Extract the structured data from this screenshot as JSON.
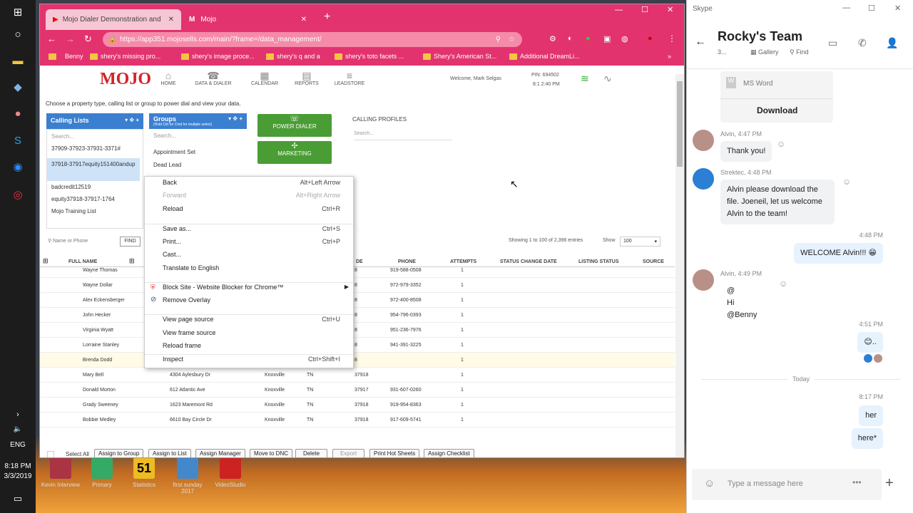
{
  "taskbar": {
    "time": "8:18 PM",
    "date": "3/3/2019",
    "lang": "ENG"
  },
  "desktop_icons": [
    {
      "label": "Kevin  Interview",
      "color": "#a34"
    },
    {
      "label": "Primary",
      "color": "#3a6"
    },
    {
      "label": "Statistics",
      "color": "#eb2",
      "badge": "51"
    },
    {
      "label": "first sunday 2017",
      "color": "#48c"
    },
    {
      "label": "VideoStudio",
      "color": "#c22"
    }
  ],
  "browser": {
    "tabs": [
      {
        "label": "Mojo Dialer Demonstration and C"
      },
      {
        "label": "Mojo"
      }
    ],
    "url": "https://app351.mojosells.com/main/?frame=/data_management/",
    "bookmarks": [
      "Benny",
      "shery's missing pro...",
      "shery's image proce...",
      "shery's q and a",
      "shery's toto facets ...",
      "Shery's American St...",
      "Additional DreamLi..."
    ]
  },
  "mojo": {
    "nav": [
      {
        "label": "HOME",
        "icon": "⌂"
      },
      {
        "label": "DATA & DIALER",
        "icon": "☎"
      },
      {
        "label": "CALENDAR",
        "icon": "▦"
      },
      {
        "label": "REPORTS",
        "icon": "▤"
      },
      {
        "label": "LEADSTORE",
        "icon": "≡"
      }
    ],
    "welcome": "Welcome, Mark Selgas",
    "pin": "PIN: 694502",
    "clock": "8:1 2:40 PM",
    "instruction": "Choose a property type, calling list or group to power dial and view your data.",
    "calling_lists": {
      "title": "Calling Lists",
      "search": "Search...",
      "items": [
        "37909-37923-37931-3371#",
        "37918-37917equity151400andup",
        "badcredit12519",
        "equity37918-37917-1764",
        "Mojo Training List"
      ]
    },
    "groups": {
      "title": "Groups",
      "subtitle": "(Hold Ctrl for Cmd for multiple select)",
      "search": "Search...",
      "items": [
        "Appointment Set",
        "Dead Lead"
      ]
    },
    "power_dialer": "POWER DIALER",
    "marketing": "MARKETING",
    "calling_profiles": "CALLING PROFILES",
    "profiles_search": "Search...",
    "name_search": "Name or Phone",
    "find": "FIND",
    "showing": "Showing 1 to 100 of 2,396 entries",
    "show_label": "Show",
    "show_val": "100",
    "columns": [
      "FULL NAME",
      "DE",
      "PHONE",
      "ATTEMPTS",
      "STATUS CHANGE DATE",
      "LISTING STATUS",
      "SOURCE"
    ],
    "rows": [
      {
        "name": "Wayne Thomas",
        "addr": "",
        "city": "",
        "st": "",
        "zip": "8",
        "phone": "919-588-0508",
        "att": "1"
      },
      {
        "name": "Wayne Dollar",
        "addr": "",
        "city": "",
        "st": "",
        "zip": "8",
        "phone": "972-979-3352",
        "att": "1"
      },
      {
        "name": "Alex Eckensberger",
        "addr": "",
        "city": "",
        "st": "",
        "zip": "8",
        "phone": "972-400-8508",
        "att": "1"
      },
      {
        "name": "John Hecker",
        "addr": "",
        "city": "",
        "st": "",
        "zip": "8",
        "phone": "954-796-0393",
        "att": "1"
      },
      {
        "name": "Virginia Wyatt",
        "addr": "",
        "city": "",
        "st": "",
        "zip": "8",
        "phone": "951-236-7976",
        "att": "1"
      },
      {
        "name": "Lorraine Stanley",
        "addr": "",
        "city": "",
        "st": "",
        "zip": "8",
        "phone": "941-391-3225",
        "att": "1"
      },
      {
        "name": "Brenda Dodd",
        "addr": "",
        "city": "",
        "st": "",
        "zip": "8",
        "phone": "",
        "att": "1"
      },
      {
        "name": "Mary Bell",
        "addr": "4304 Aylesbury Dr",
        "city": "Knoxville",
        "st": "TN",
        "zip": "37918",
        "phone": "",
        "att": "1"
      },
      {
        "name": "Donald Morton",
        "addr": "612 Atlantic Ave",
        "city": "Knoxville",
        "st": "TN",
        "zip": "37917",
        "phone": "931-607-0260",
        "att": "1"
      },
      {
        "name": "Grady Sweeney",
        "addr": "1623 Maremont Rd",
        "city": "Knoxville",
        "st": "TN",
        "zip": "37918",
        "phone": "919-954-8363",
        "att": "1"
      },
      {
        "name": "Bobbie Medley",
        "addr": "6610 Bay Circle Dr",
        "city": "Knoxville",
        "st": "TN",
        "zip": "37918",
        "phone": "917-609-5741",
        "att": "1"
      }
    ],
    "select_all": "Select All",
    "actions": [
      "Assign to Group",
      "Assign to List",
      "Assign Manager",
      "Move to DNC",
      "Delete",
      "Export",
      "Print Hot Sheets",
      "Assign Checklist"
    ]
  },
  "context_menu": [
    {
      "label": "Back",
      "shortcut": "Alt+Left Arrow",
      "disabled": false
    },
    {
      "label": "Forward",
      "shortcut": "Alt+Right Arrow",
      "disabled": true
    },
    {
      "label": "Reload",
      "shortcut": "Ctrl+R",
      "disabled": false
    },
    {
      "label": "Save as...",
      "shortcut": "Ctrl+S",
      "disabled": false
    },
    {
      "label": "Print...",
      "shortcut": "Ctrl+P",
      "disabled": false
    },
    {
      "label": "Cast...",
      "shortcut": "",
      "disabled": false
    },
    {
      "label": "Translate to English",
      "shortcut": "",
      "disabled": false
    },
    {
      "label": "Block Site - Website Blocker for Chrome™",
      "shortcut": "",
      "disabled": false
    },
    {
      "label": "Remove Overlay",
      "shortcut": "",
      "disabled": false
    },
    {
      "label": "View page source",
      "shortcut": "Ctrl+U",
      "disabled": false
    },
    {
      "label": "View frame source",
      "shortcut": "",
      "disabled": false
    },
    {
      "label": "Reload frame",
      "shortcut": "",
      "disabled": false
    },
    {
      "label": "Inspect",
      "shortcut": "Ctrl+Shift+I",
      "disabled": false
    }
  ],
  "skype": {
    "app": "Skype",
    "chat_title": "Rocky's Team",
    "member_count": "3...",
    "gallery": "Gallery",
    "find": "Find",
    "file_name": "MS Word",
    "download": "Download",
    "messages": [
      {
        "meta": "Alvin, 4:47 PM",
        "text": "Thank you!"
      },
      {
        "meta": "Strektec, 4:48 PM",
        "text": "Alvin please download the file. Joeneil, let us welcome Alvin to the team!"
      },
      {
        "meta": "4:48 PM",
        "text": "WELCOME Alvin!!! 😁"
      },
      {
        "meta": "Alvin, 4:49 PM",
        "text": "@",
        "text2": "Hi @Benny"
      },
      {
        "meta": "4:51 PM",
        "text": "😊.."
      },
      {
        "meta": "Today"
      },
      {
        "meta": "8:17 PM",
        "text": "her",
        "text2": "here*"
      }
    ],
    "placeholder": "Type a message here"
  }
}
